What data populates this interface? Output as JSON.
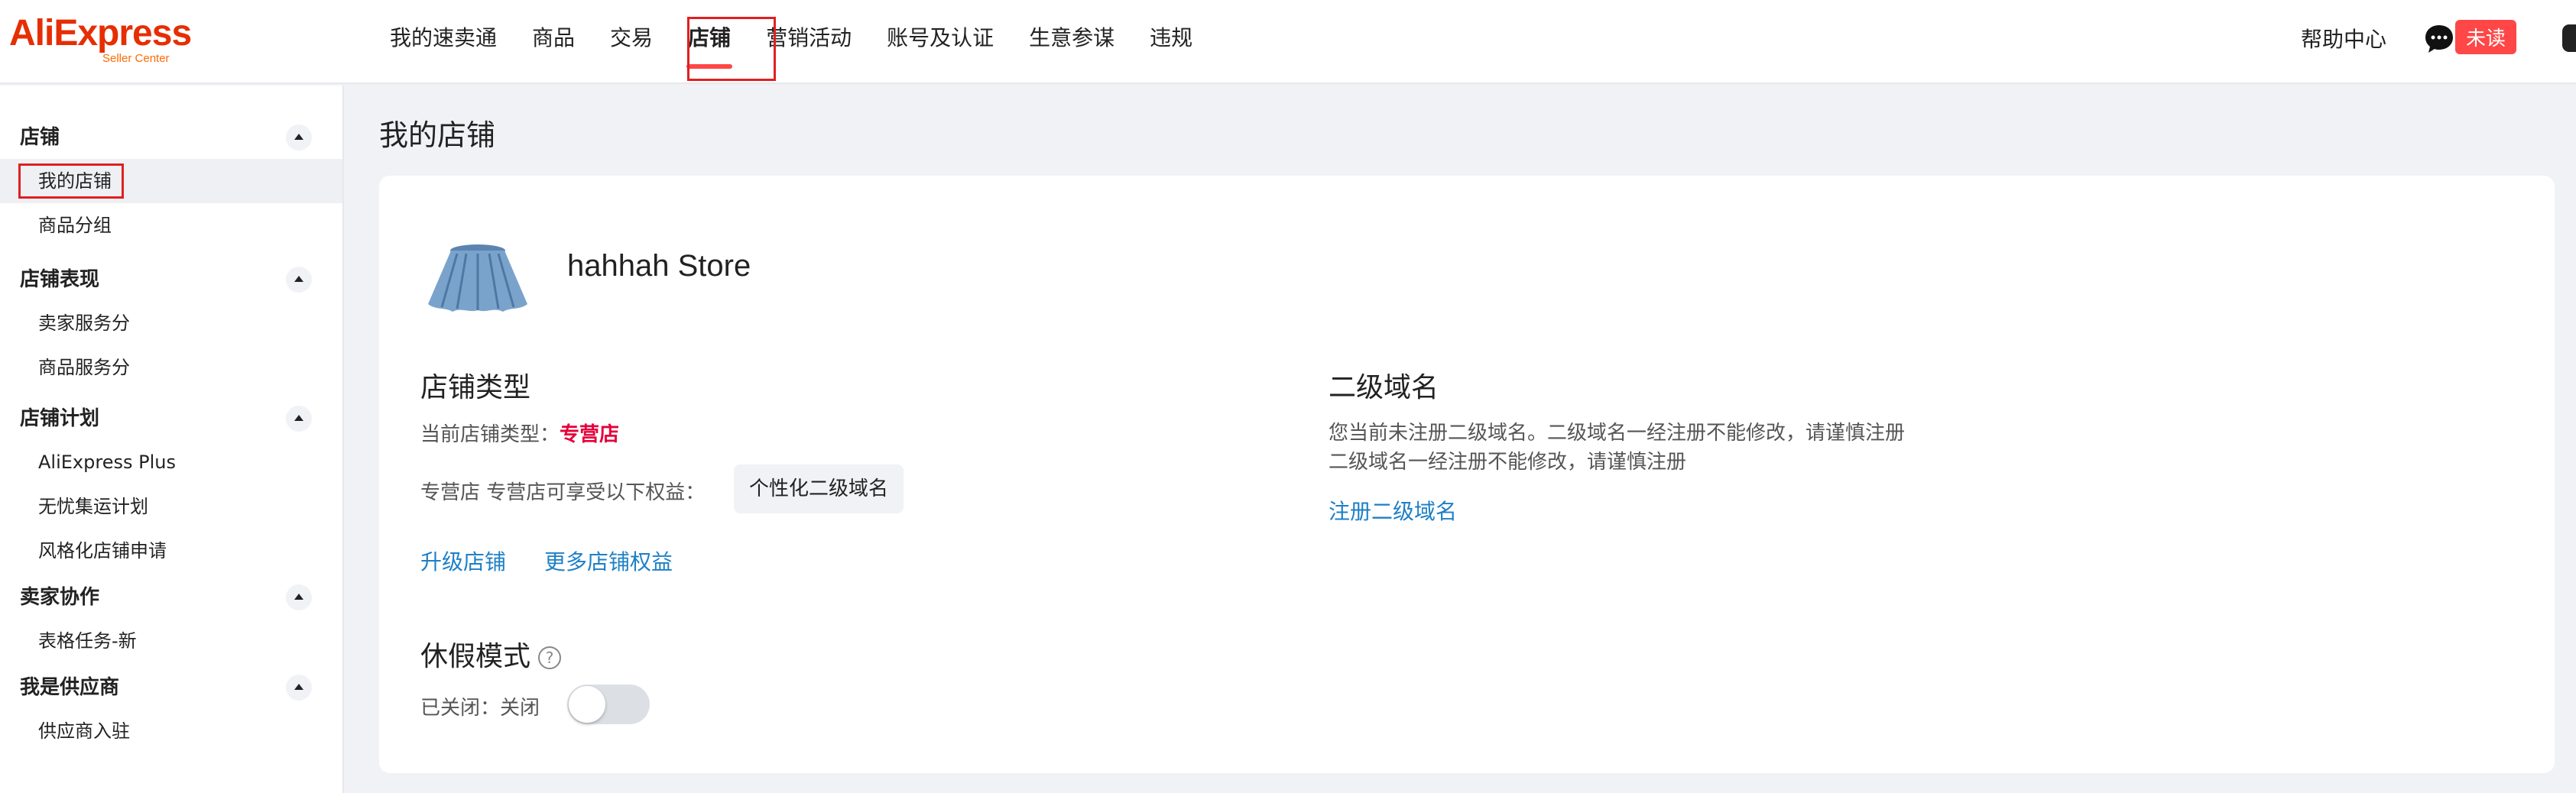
{
  "header": {
    "logo_main": "AliExpress",
    "logo_sub": "Seller Center",
    "nav": [
      {
        "label": "我的速卖通"
      },
      {
        "label": "商品"
      },
      {
        "label": "交易"
      },
      {
        "label": "店铺"
      },
      {
        "label": "营销活动"
      },
      {
        "label": "账号及认证"
      },
      {
        "label": "生意参谋"
      },
      {
        "label": "违规"
      }
    ],
    "active_nav": "店铺",
    "help": "帮助中心",
    "unread": "未读",
    "colors": {
      "brand": "#e62e04",
      "accent": "#ff4747",
      "link": "#1e7fc6"
    }
  },
  "sidebar": {
    "groups": [
      {
        "title": "店铺",
        "items": [
          "我的店铺",
          "商品分组"
        ]
      },
      {
        "title": "店铺表现",
        "items": [
          "卖家服务分",
          "商品服务分"
        ]
      },
      {
        "title": "店铺计划",
        "items": [
          "AliExpress Plus",
          "无忧集运计划",
          "风格化店铺申请"
        ]
      },
      {
        "title": "卖家协作",
        "items": [
          "表格任务-新"
        ]
      },
      {
        "title": "我是供应商",
        "items": [
          "供应商入驻"
        ]
      }
    ],
    "active_item": "我的店铺"
  },
  "main": {
    "page_title": "我的店铺",
    "store_name": "hahhah Store",
    "store_type": {
      "title": "店铺类型",
      "current_label": "当前店铺类型：",
      "current_value": "专营店",
      "benefits_label": "专营店 专营店可享受以下权益：",
      "benefit_tag": "个性化二级域名",
      "upgrade_link": "升级店铺",
      "more_link": "更多店铺权益"
    },
    "domain": {
      "title": "二级域名",
      "desc_line1": "您当前未注册二级域名。二级域名一经注册不能修改，请谨慎注册",
      "desc_line2": "二级域名一经注册不能修改，请谨慎注册",
      "register_link": "注册二级域名"
    },
    "vacation": {
      "title": "休假模式",
      "status_label": "已关闭：关闭",
      "enabled": false
    }
  }
}
